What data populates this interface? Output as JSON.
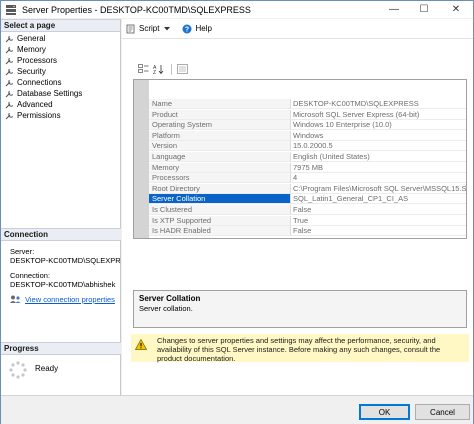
{
  "window": {
    "title": "Server Properties - DESKTOP-KC00TMD\\SQLEXPRESS",
    "minimize_glyph": "—",
    "maximize_glyph": "☐",
    "close_glyph": "✕"
  },
  "left": {
    "select_page_header": "Select a page",
    "pages": [
      {
        "label": "General"
      },
      {
        "label": "Memory"
      },
      {
        "label": "Processors"
      },
      {
        "label": "Security"
      },
      {
        "label": "Connections"
      },
      {
        "label": "Database Settings"
      },
      {
        "label": "Advanced"
      },
      {
        "label": "Permissions"
      }
    ],
    "connection_header": "Connection",
    "server_label": "Server:",
    "server_value": "DESKTOP-KC00TMD\\SQLEXPR",
    "connection_label": "Connection:",
    "connection_value": "DESKTOP-KC00TMD\\abhishek",
    "view_connection_link": "View connection properties",
    "progress_header": "Progress",
    "progress_status": "Ready"
  },
  "toolbar": {
    "script_label": "Script",
    "help_label": "Help"
  },
  "properties": [
    {
      "name": "Name",
      "value": "DESKTOP-KC00TMD\\SQLEXPRESS"
    },
    {
      "name": "Product",
      "value": "Microsoft SQL Server Express (64-bit)"
    },
    {
      "name": "Operating System",
      "value": "Windows 10 Enterprise (10.0)"
    },
    {
      "name": "Platform",
      "value": "Windows"
    },
    {
      "name": "Version",
      "value": "15.0.2000.5"
    },
    {
      "name": "Language",
      "value": "English (United States)"
    },
    {
      "name": "Memory",
      "value": "7975 MB"
    },
    {
      "name": "Processors",
      "value": "4"
    },
    {
      "name": "Root Directory",
      "value": "C:\\Program Files\\Microsoft SQL Server\\MSSQL15.S"
    },
    {
      "name": "Server Collation",
      "value": "SQL_Latin1_General_CP1_CI_AS",
      "selected": true
    },
    {
      "name": "Is Clustered",
      "value": "False"
    },
    {
      "name": "Is XTP Supported",
      "value": "True"
    },
    {
      "name": "Is HADR Enabled",
      "value": "False"
    }
  ],
  "description": {
    "title": "Server Collation",
    "text": "Server collation."
  },
  "warning": {
    "text": "Changes to server properties and settings may affect the performance, security, and availability of this SQL Server instance. Before making any such changes, consult the product documentation."
  },
  "buttons": {
    "ok": "OK",
    "cancel": "Cancel"
  },
  "colors": {
    "selection": "#0a64c8",
    "warning_bg": "#fff8c4",
    "link": "#0b5bd3"
  }
}
